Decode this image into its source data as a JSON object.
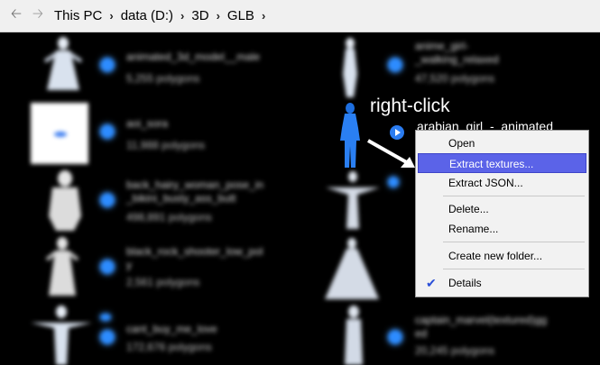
{
  "breadcrumb": {
    "back_icon": "back-arrow-icon",
    "forward_icon": "forward-arrow-icon",
    "items": [
      "This PC",
      "data (D:)",
      "3D",
      "GLB"
    ],
    "separator": "›"
  },
  "files": [
    {
      "title": "animated_3d_model__male",
      "subtitle": "5,255 polygons"
    },
    {
      "title": "anime_girl-\n_walking_relaxed",
      "subtitle": "47,520 polygons"
    },
    {
      "title": "aoi_sora",
      "subtitle": "11,988 polygons"
    },
    {
      "title": "back_hairy_woman_pose_in\n_bikini_busty_ass_butt",
      "subtitle": "498,891 polygons"
    },
    {
      "title": "black_rock_shooter_low_pol\ny",
      "subtitle": "2,561 polygons"
    },
    {
      "title": "cant_buy_me_love",
      "subtitle": "172,676 polygons"
    },
    {
      "title": "captain_marvel(textured)gg\ned",
      "subtitle": "20,245 polygons"
    }
  ],
  "highlighted": {
    "annotation": "right-click",
    "title": "arabian_girl_-_animated"
  },
  "context_menu": {
    "items": [
      {
        "label": "Open"
      },
      {
        "label": "Extract textures...",
        "selected": true
      },
      {
        "label": "Extract JSON..."
      },
      {
        "label": "Delete..."
      },
      {
        "label": "Rename..."
      },
      {
        "label": "Create new folder..."
      },
      {
        "label": "Details",
        "checked": true
      }
    ]
  },
  "colors": {
    "selection": "#5b63e8",
    "accent": "#2d8cff"
  }
}
